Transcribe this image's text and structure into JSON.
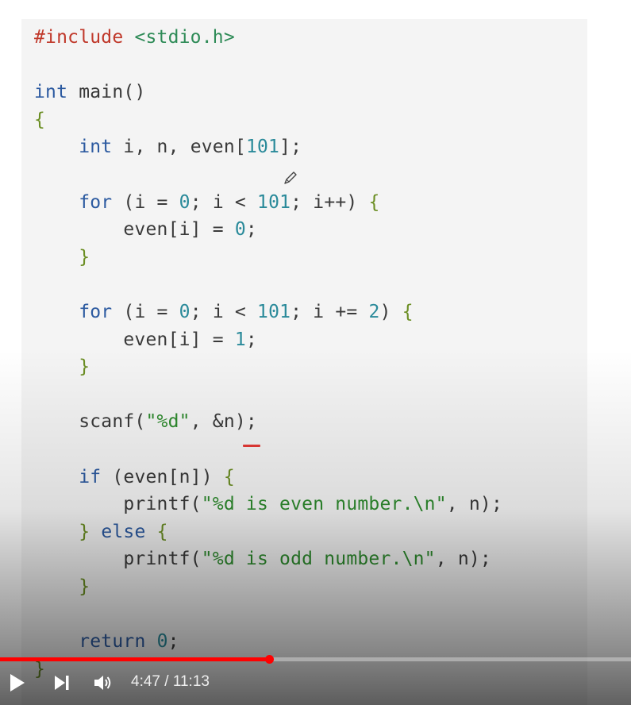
{
  "code": {
    "lines": [
      [
        {
          "t": "#include ",
          "c": "pp"
        },
        {
          "t": "<stdio.h>",
          "c": "inc"
        }
      ],
      [],
      [
        {
          "t": "int",
          "c": "kw"
        },
        {
          "t": " main()",
          "c": "fn"
        }
      ],
      [
        {
          "t": "{",
          "c": "brace"
        }
      ],
      [
        {
          "t": "    ",
          "c": ""
        },
        {
          "t": "int",
          "c": "kw"
        },
        {
          "t": " i, n, even[",
          "c": ""
        },
        {
          "t": "101",
          "c": "num"
        },
        {
          "t": "];",
          "c": ""
        }
      ],
      [],
      [
        {
          "t": "    ",
          "c": ""
        },
        {
          "t": "for",
          "c": "kw"
        },
        {
          "t": " (i = ",
          "c": ""
        },
        {
          "t": "0",
          "c": "num"
        },
        {
          "t": "; i < ",
          "c": ""
        },
        {
          "t": "101",
          "c": "num"
        },
        {
          "t": "; i++) ",
          "c": ""
        },
        {
          "t": "{",
          "c": "brace"
        }
      ],
      [
        {
          "t": "        even[i] = ",
          "c": ""
        },
        {
          "t": "0",
          "c": "num"
        },
        {
          "t": ";",
          "c": ""
        }
      ],
      [
        {
          "t": "    ",
          "c": ""
        },
        {
          "t": "}",
          "c": "brace"
        }
      ],
      [],
      [
        {
          "t": "    ",
          "c": ""
        },
        {
          "t": "for",
          "c": "kw"
        },
        {
          "t": " (i = ",
          "c": ""
        },
        {
          "t": "0",
          "c": "num"
        },
        {
          "t": "; i < ",
          "c": ""
        },
        {
          "t": "101",
          "c": "num"
        },
        {
          "t": "; i += ",
          "c": ""
        },
        {
          "t": "2",
          "c": "num"
        },
        {
          "t": ") ",
          "c": ""
        },
        {
          "t": "{",
          "c": "brace"
        }
      ],
      [
        {
          "t": "        even[i] = ",
          "c": ""
        },
        {
          "t": "1",
          "c": "num"
        },
        {
          "t": ";",
          "c": ""
        }
      ],
      [
        {
          "t": "    ",
          "c": ""
        },
        {
          "t": "}",
          "c": "brace"
        }
      ],
      [],
      [
        {
          "t": "    scanf(",
          "c": ""
        },
        {
          "t": "\"%d\"",
          "c": "str"
        },
        {
          "t": ", &n);",
          "c": ""
        }
      ],
      [],
      [
        {
          "t": "    ",
          "c": ""
        },
        {
          "t": "if",
          "c": "kw"
        },
        {
          "t": " (even[n]) ",
          "c": ""
        },
        {
          "t": "{",
          "c": "brace"
        }
      ],
      [
        {
          "t": "        printf(",
          "c": ""
        },
        {
          "t": "\"%d is even number.\\n\"",
          "c": "str"
        },
        {
          "t": ", n);",
          "c": ""
        }
      ],
      [
        {
          "t": "    ",
          "c": ""
        },
        {
          "t": "}",
          "c": "brace"
        },
        {
          "t": " ",
          "c": ""
        },
        {
          "t": "else",
          "c": "kw"
        },
        {
          "t": " ",
          "c": ""
        },
        {
          "t": "{",
          "c": "brace"
        }
      ],
      [
        {
          "t": "        printf(",
          "c": ""
        },
        {
          "t": "\"%d is odd number.\\n\"",
          "c": "str"
        },
        {
          "t": ", n);",
          "c": ""
        }
      ],
      [
        {
          "t": "    ",
          "c": ""
        },
        {
          "t": "}",
          "c": "brace"
        }
      ],
      [],
      [
        {
          "t": "    ",
          "c": ""
        },
        {
          "t": "return",
          "c": "kw"
        },
        {
          "t": " ",
          "c": ""
        },
        {
          "t": "0",
          "c": "num"
        },
        {
          "t": ";",
          "c": ""
        }
      ],
      [
        {
          "t": "}",
          "c": "brace"
        }
      ]
    ]
  },
  "player": {
    "current_time": "4:47",
    "duration": "11:13",
    "time_display": "4:47 / 11:13",
    "progress": 0.4265,
    "colors": {
      "accent": "#ff0000",
      "text": "#eeeeee"
    },
    "icons": {
      "play": "play-icon",
      "next": "next-icon",
      "volume": "volume-icon",
      "pencil": "pencil-cursor-icon"
    }
  }
}
